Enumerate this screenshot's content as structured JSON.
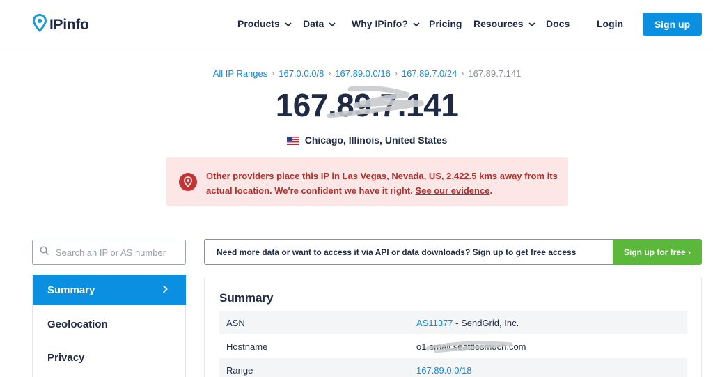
{
  "header": {
    "logo_text": "IPinfo",
    "nav": [
      {
        "label": "Products",
        "has_dropdown": true
      },
      {
        "label": "Data",
        "has_dropdown": true
      },
      {
        "label": "Why IPinfo?",
        "has_dropdown": true
      },
      {
        "label": "Pricing",
        "has_dropdown": false
      },
      {
        "label": "Resources",
        "has_dropdown": true
      },
      {
        "label": "Docs",
        "has_dropdown": false
      }
    ],
    "login_label": "Login",
    "signup_label": "Sign up"
  },
  "breadcrumb": [
    {
      "label": "All IP Ranges"
    },
    {
      "label": "167.0.0.0/8"
    },
    {
      "label": "167.89.0.0/16"
    },
    {
      "label": "167.89.7.0/24"
    },
    {
      "label": "167.89.7.141"
    }
  ],
  "ip": {
    "title": "167.89.7.141",
    "location": "Chicago, Illinois, United States"
  },
  "alert": {
    "text": "Other providers place this IP in Las Vegas, Nevada, US, 2,422.5 kms away from its actual location. We're confident we have it right.",
    "link_label": "See our evidence",
    "suffix": "."
  },
  "sidebar": {
    "search_placeholder": "Search an IP or AS number",
    "items": [
      {
        "label": "Summary",
        "active": true
      },
      {
        "label": "Geolocation",
        "active": false
      },
      {
        "label": "Privacy",
        "active": false
      }
    ]
  },
  "cta": {
    "text": "Need more data or want to access it via API or data downloads? Sign up to get free access",
    "button_label": "Sign up for free ›"
  },
  "summary": {
    "title": "Summary",
    "rows": [
      {
        "key": "ASN",
        "value_link": "AS11377",
        "value_rest": " - SendGrid, Inc."
      },
      {
        "key": "Hostname",
        "value_text": "o1.email.seattlesmuch.com"
      },
      {
        "key": "Range",
        "value_link": "167.89.0.0/18"
      }
    ]
  },
  "colors": {
    "brand_blue": "#0b8fe0",
    "navy_text": "#1f2a44",
    "alert_bg": "#fde6e6",
    "alert_text": "#b0302b",
    "cta_green": "#5cb83a"
  }
}
